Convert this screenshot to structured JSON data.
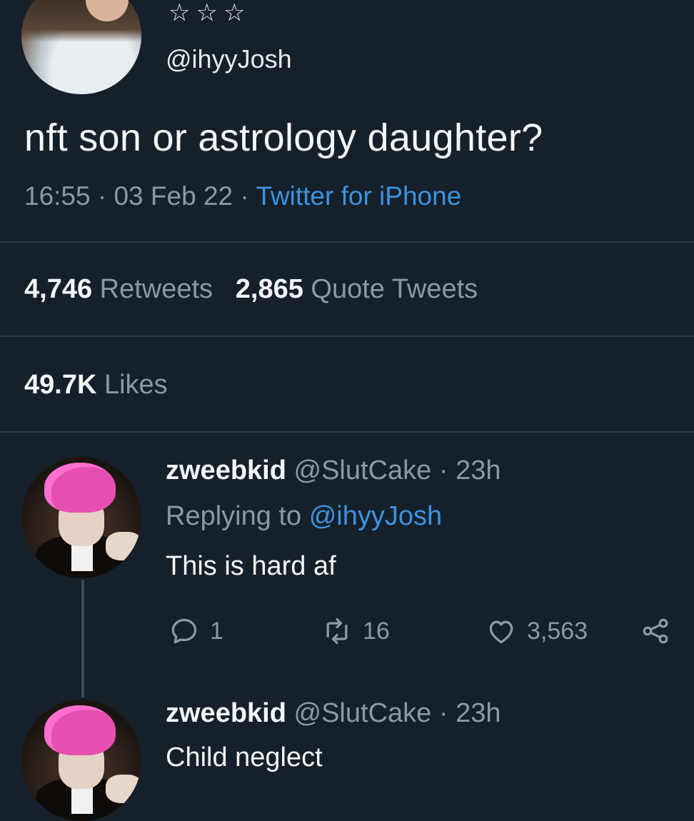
{
  "tweet": {
    "stars": "☆☆☆",
    "handle": "@ihyyJosh",
    "text": "nft son or astrology daughter?",
    "time": "16:55",
    "date": "03 Feb 22",
    "source": "Twitter for iPhone",
    "separator": "·",
    "retweets_count": "4,746",
    "retweets_label": "Retweets",
    "quotes_count": "2,865",
    "quotes_label": "Quote Tweets",
    "likes_count": "49.7K",
    "likes_label": "Likes"
  },
  "replies": [
    {
      "name": "zweebkid",
      "handle": "@SlutCake",
      "age": "23h",
      "replying_prefix": "Replying to",
      "replying_to": "@ihyyJosh",
      "text": "This is hard af",
      "reply_count": "1",
      "retweet_count": "16",
      "like_count": "3,563"
    },
    {
      "name": "zweebkid",
      "handle": "@SlutCake",
      "age": "23h",
      "text": "Child neglect"
    }
  ],
  "icons": {
    "reply": "reply-icon",
    "retweet": "retweet-icon",
    "like": "heart-icon",
    "share": "share-icon"
  },
  "colors": {
    "background": "#15202b",
    "link": "#3d93e0",
    "secondary_text": "#8b98a5",
    "primary_text": "#f4f6f7"
  }
}
